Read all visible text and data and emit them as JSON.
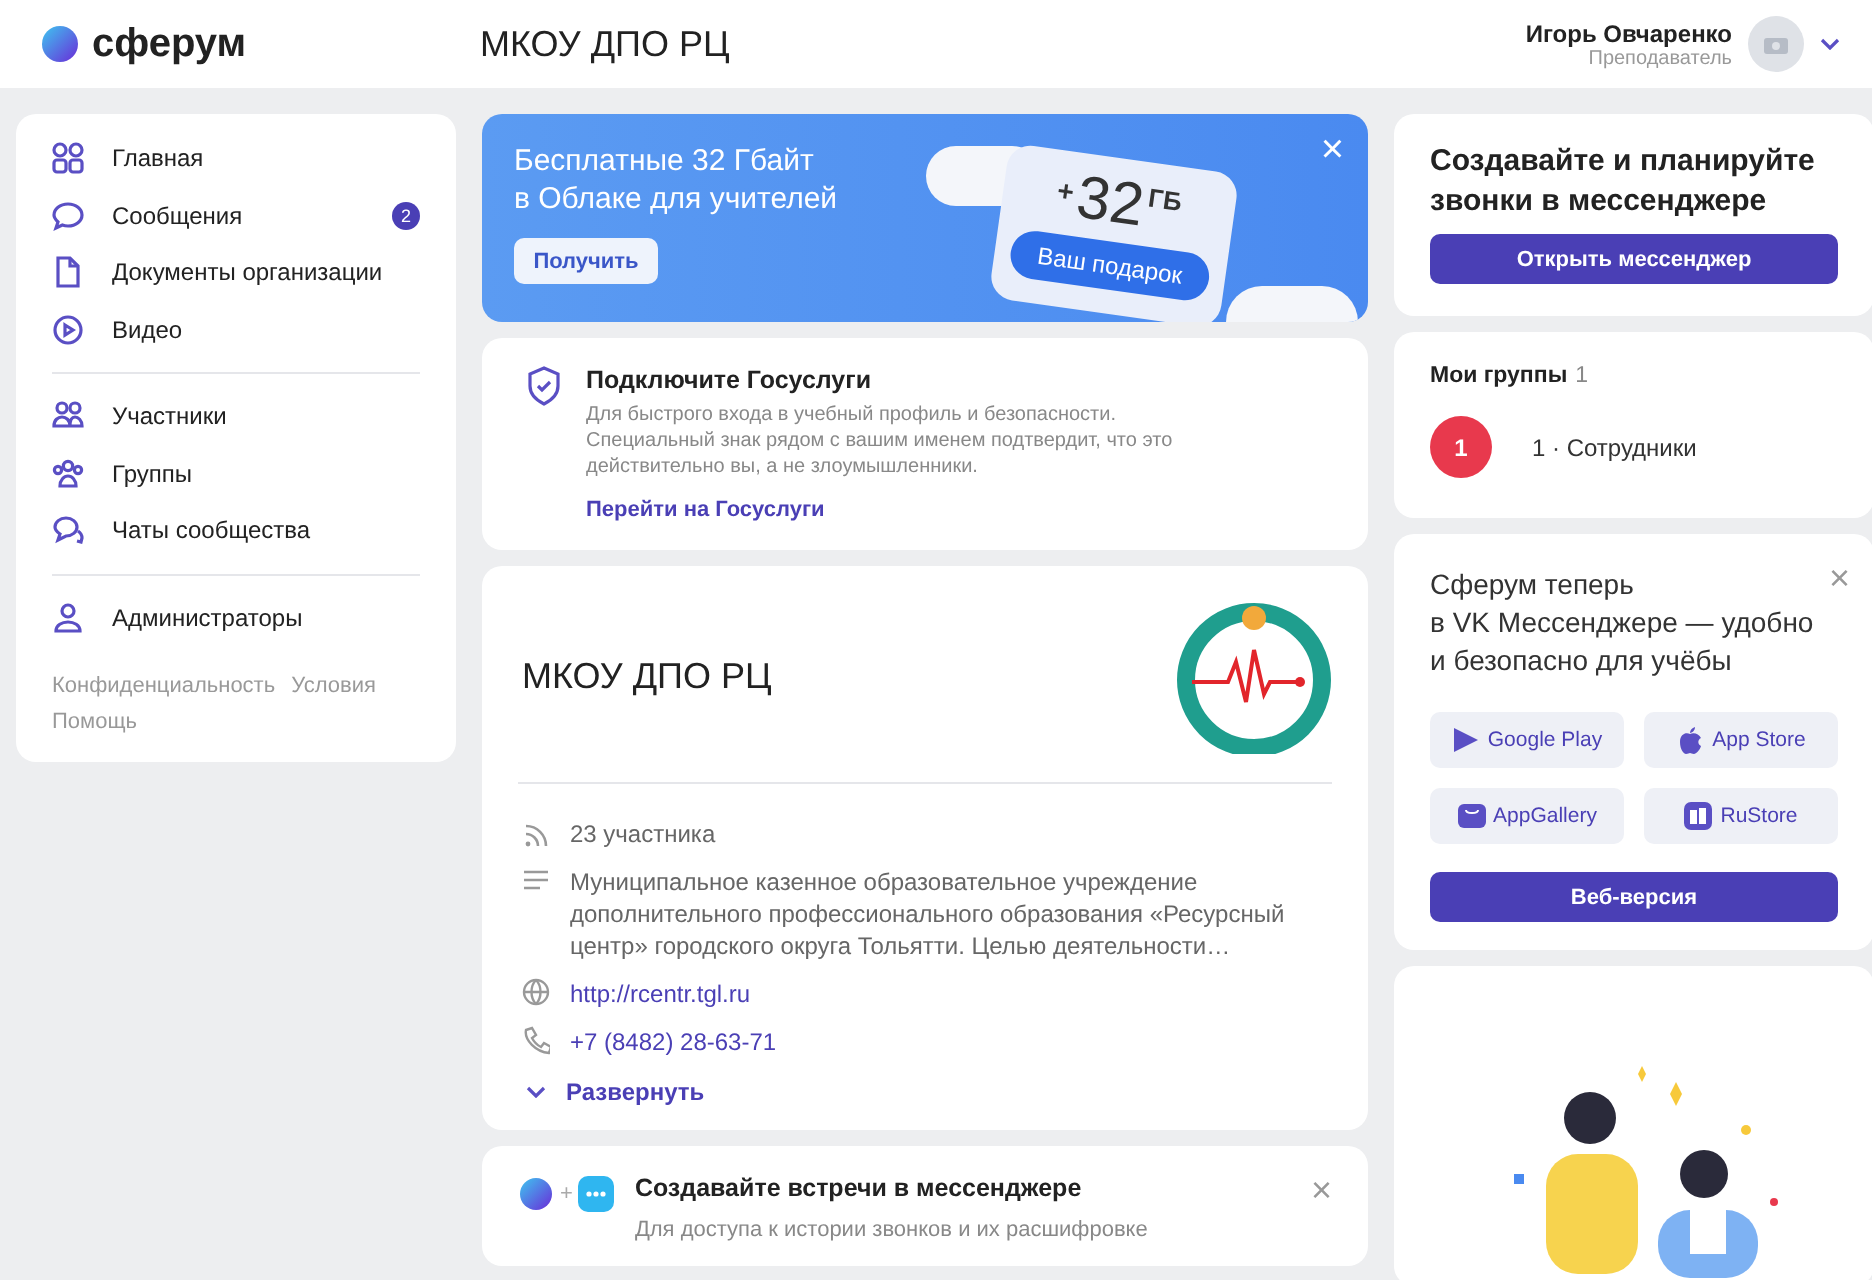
{
  "header": {
    "logo": "сферум",
    "title": "МКОУ ДПО РЦ",
    "user": {
      "name": "Игорь Овчаренко",
      "role": "Преподаватель"
    }
  },
  "sidebar": {
    "groups": [
      [
        {
          "label": "Главная"
        },
        {
          "label": "Сообщения",
          "badge": "2"
        },
        {
          "label": "Документы организации"
        },
        {
          "label": "Видео"
        }
      ],
      [
        {
          "label": "Участники"
        },
        {
          "label": "Группы"
        },
        {
          "label": "Чаты сообщества"
        }
      ],
      [
        {
          "label": "Администраторы"
        }
      ]
    ],
    "footer_links": [
      "Конфиденциальность",
      "Условия",
      "Помощь"
    ]
  },
  "promo": {
    "title_lines": [
      "Бесплатные 32 Гбайт",
      "в Облаке для учителей"
    ],
    "button": "Получить",
    "gift_plus": "+",
    "gift_amount": "32",
    "gift_unit": "ГБ",
    "gift_label": "Ваш подарок",
    "close": "×"
  },
  "gosuslugi": {
    "title": "Подключите Госуслуги",
    "text": "Для быстрого входа в учебный профиль и безопасности. Специальный знак рядом с вашим именем подтвердит, что это действительно вы, а не злоумышленники.",
    "link": "Перейти на Госуслуги"
  },
  "organization": {
    "name": "МКОУ ДПО РЦ",
    "details": [
      {
        "kind": "members",
        "text": "23 участника"
      },
      {
        "kind": "description",
        "text": "Муниципальное казенное образовательное учреждение дополнительного профессионального образования «Ресурсный центр» городского округа Тольятти. Целью деятельности…"
      },
      {
        "kind": "website",
        "text": "http://rcentr.tgl.ru"
      },
      {
        "kind": "phone",
        "text": "+7 (8482) 28-63-71"
      }
    ],
    "expand": "Развернуть"
  },
  "meetings": {
    "title": "Создавайте встречи в мессенджере",
    "plus": "+",
    "text": "Для доступа к истории звонков и их расшифровке",
    "close": "×"
  },
  "messenger": {
    "title": "Создавайте и планируйте звонки в мессенджере",
    "button": "Открыть мессенджер"
  },
  "groups": {
    "title": "Мои группы",
    "count": "1",
    "items": [
      {
        "badge": "1",
        "name": "1 · Сотрудники",
        "color": "#e8394d"
      }
    ]
  },
  "vk": {
    "text_lines": [
      "Сферум теперь",
      "в VK Мессенджере — удобно",
      "и безопасно для учёбы"
    ],
    "close": "×",
    "stores": [
      {
        "kind": "google",
        "label": "Google Play"
      },
      {
        "kind": "apple",
        "label": "App Store"
      },
      {
        "kind": "huawei",
        "label": "AppGallery"
      },
      {
        "kind": "rustore",
        "label": "RuStore"
      }
    ],
    "button": "Веб-версия"
  }
}
